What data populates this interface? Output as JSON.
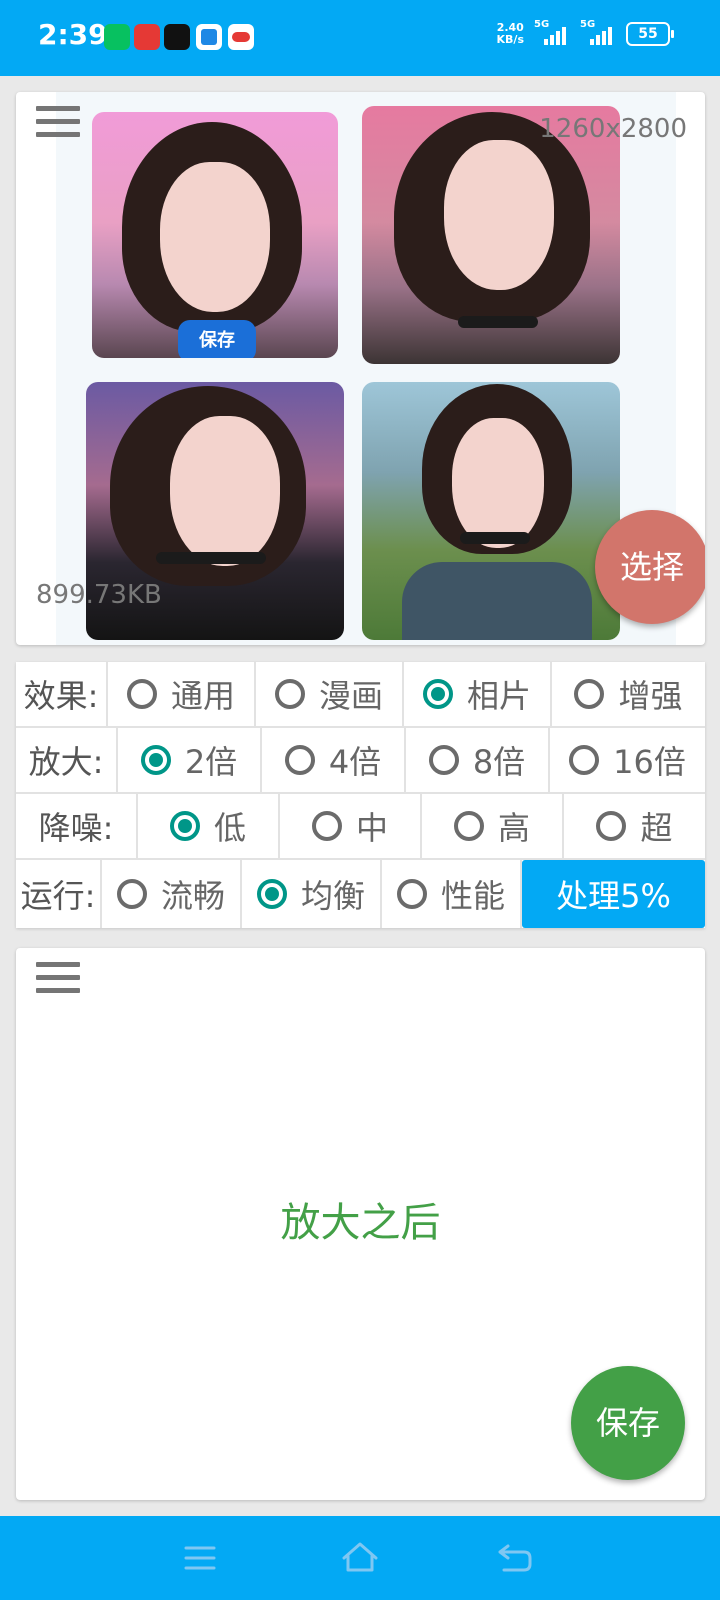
{
  "status_bar": {
    "time": "2:39",
    "net_speed_value": "2.40",
    "net_speed_unit": "KB/s",
    "sim1_label": "5G",
    "sim2_label": "5G",
    "battery": "55",
    "notification_icons": [
      "wechat-icon",
      "game-icon",
      "tiktok-icon",
      "app-icon",
      "cloud-app-icon"
    ]
  },
  "preview": {
    "resolution": "1260x2800",
    "file_size": "899.73KB",
    "inner_save_label": "保存",
    "select_button": "选择"
  },
  "options": {
    "effect": {
      "label": "效果:",
      "items": [
        "通用",
        "漫画",
        "相片",
        "增强"
      ],
      "selected": "相片"
    },
    "scale": {
      "label": "放大:",
      "items": [
        "2倍",
        "4倍",
        "8倍",
        "16倍"
      ],
      "selected": "2倍"
    },
    "denoise": {
      "label": "降噪:",
      "items": [
        "低",
        "中",
        "高",
        "超"
      ],
      "selected": "低"
    },
    "run": {
      "label": "运行:",
      "items": [
        "流畅",
        "均衡",
        "性能"
      ],
      "selected": "均衡",
      "process_button": "处理5%"
    }
  },
  "result": {
    "placeholder": "放大之后",
    "save_button": "保存"
  },
  "colors": {
    "primary": "#03A9F4",
    "radio_selected": "#009688",
    "select_fab": "#d2756b",
    "save_fab": "#43a047"
  }
}
